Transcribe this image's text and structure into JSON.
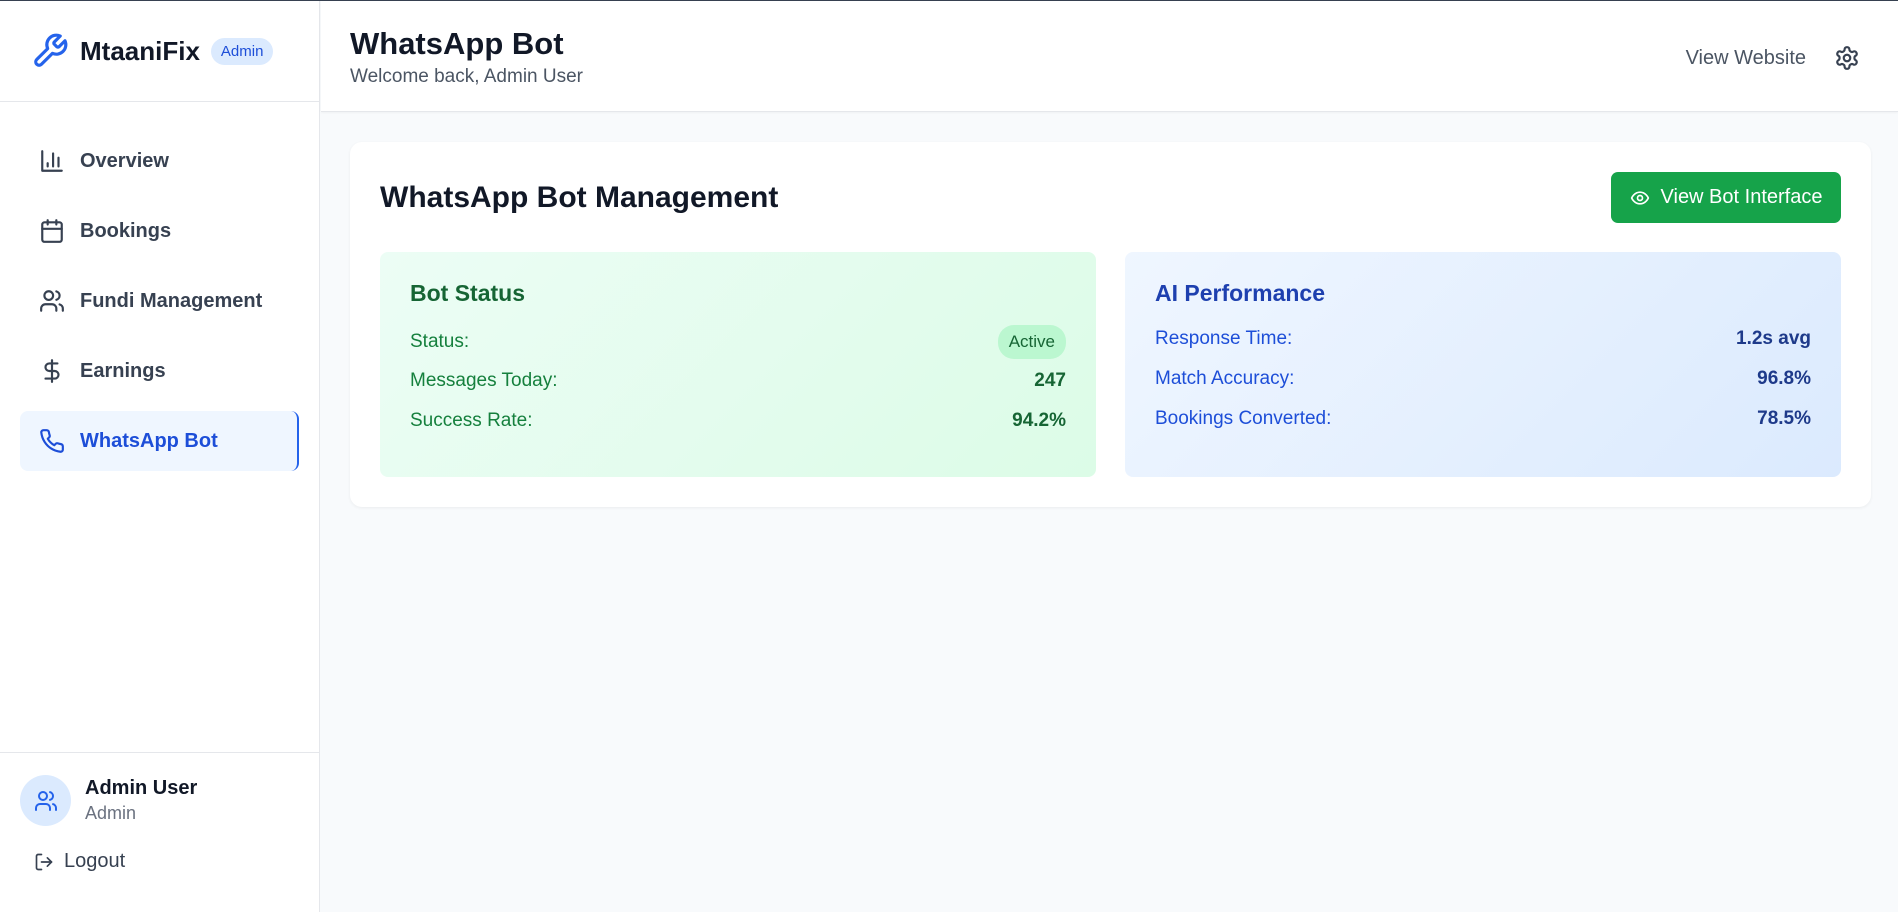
{
  "app": {
    "name": "MtaaniFix",
    "badge": "Admin"
  },
  "sidebar": {
    "items": [
      {
        "label": "Overview",
        "icon": "bar-chart-icon"
      },
      {
        "label": "Bookings",
        "icon": "calendar-icon"
      },
      {
        "label": "Fundi Management",
        "icon": "users-icon"
      },
      {
        "label": "Earnings",
        "icon": "dollar-icon"
      },
      {
        "label": "WhatsApp Bot",
        "icon": "phone-icon",
        "active": true
      }
    ],
    "user": {
      "name": "Admin User",
      "role": "Admin"
    },
    "logout_label": "Logout"
  },
  "header": {
    "title": "WhatsApp Bot",
    "subtitle": "Welcome back, Admin User",
    "view_website": "View Website"
  },
  "main": {
    "title": "WhatsApp Bot Management",
    "view_bot_button": "View Bot Interface",
    "bot_status": {
      "title": "Bot Status",
      "status_label": "Status:",
      "status_value": "Active",
      "messages_label": "Messages Today:",
      "messages_value": "247",
      "success_label": "Success Rate:",
      "success_value": "94.2%"
    },
    "ai_performance": {
      "title": "AI Performance",
      "response_label": "Response Time:",
      "response_value": "1.2s avg",
      "accuracy_label": "Match Accuracy:",
      "accuracy_value": "96.8%",
      "bookings_label": "Bookings Converted:",
      "bookings_value": "78.5%"
    }
  },
  "colors": {
    "accent": "#2563eb",
    "success": "#16a34a",
    "active_bg": "#eff6ff"
  }
}
